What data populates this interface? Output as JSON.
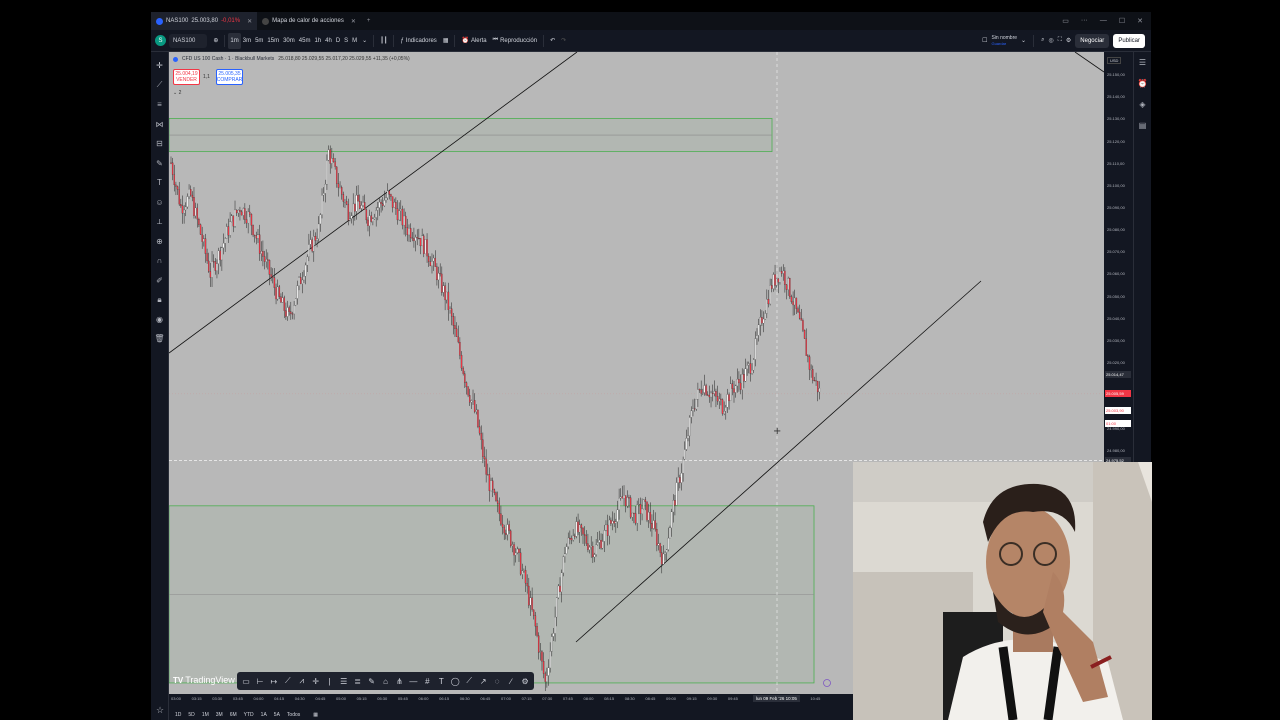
{
  "browser": {
    "tabs": [
      {
        "symbol": "NAS100",
        "price": "25.003,80",
        "change": "-0,01%"
      },
      {
        "label": "Mapa de calor de acciones"
      }
    ],
    "new_tab": "+"
  },
  "toolbar": {
    "avatar_letter": "S",
    "symbol": "NAS100",
    "intervals": [
      "1m",
      "3m",
      "5m",
      "15m",
      "30m",
      "45m",
      "1h",
      "4h",
      "D",
      "S",
      "M"
    ],
    "active_interval": "1m",
    "indicators_label": "Indicadores",
    "alert_label": "Alerta",
    "replay_label": "Reproducción",
    "layout_name": "Sin nombre",
    "layout_sub": "Guardar",
    "trade_label": "Negociar",
    "publish_label": "Publicar"
  },
  "legend": {
    "title": "CFD US 100 Cash · 1 · Blackbull Markets",
    "ohlc": "25.018,80  25.029,55  25.017,20  25.029,55 +11,35 (+0,05%)",
    "sell_price": "25.004,19",
    "sell_label": "VENDER",
    "spread": "1,1",
    "buy_price": "25.005,35",
    "buy_label": "COMPRAR",
    "indicator_count": "2"
  },
  "price_axis": {
    "currency": "USD",
    "ticks": [
      "25.150,00",
      "25.140,00",
      "25.130,00",
      "25.120,00",
      "25.110,00",
      "25.100,00",
      "25.090,00",
      "25.080,00",
      "25.070,00",
      "25.060,00",
      "25.050,00",
      "25.040,00",
      "25.030,00",
      "25.020,00",
      "24.990,00",
      "24.980,00",
      "24.970,00"
    ],
    "last_price": "25.014,47",
    "current_price": "25.005,59",
    "current_price_2": "25.003,90",
    "countdown": "01:00",
    "crosshair_price": "24.975,52"
  },
  "time_axis": {
    "ticks": [
      "03:00",
      "03:15",
      "03:30",
      "03:45",
      "04:00",
      "04:15",
      "04:30",
      "04:45",
      "05:00",
      "05:15",
      "05:30",
      "05:45",
      "06:00",
      "06:15",
      "06:30",
      "06:45",
      "07:00",
      "07:15",
      "07:30",
      "07:45",
      "08:00",
      "08:15",
      "08:30",
      "08:45",
      "09:00",
      "09:15",
      "09:30",
      "09:45",
      "10:00",
      "10:15",
      "10:30",
      "10:45"
    ],
    "crosshair_date": "lun 09 Feb '26   10:05"
  },
  "logo": "TradingView",
  "ranges": [
    "1D",
    "5D",
    "1M",
    "3M",
    "6M",
    "YTD",
    "1A",
    "5A",
    "Todos"
  ],
  "icons": {
    "left": [
      "crosshair-icon",
      "trendline-icon",
      "fib-icon",
      "pattern-icon",
      "prediction-icon",
      "brush-icon",
      "text-icon",
      "emoji-icon",
      "ruler-icon",
      "zoom-icon",
      "magnet-icon",
      "stay-drawing-icon",
      "lock-icon",
      "hide-icon",
      "trash-icon"
    ],
    "right": [
      "watchlist-icon",
      "alerts-icon",
      "layers-icon",
      "notes-icon"
    ]
  },
  "colors": {
    "bg": "#131722",
    "chart_bg": "#b8b8b8",
    "up": "#ffffff",
    "down": "#f23645",
    "zone": "#4caf50",
    "accent": "#2962ff"
  },
  "chart_data": {
    "type": "line",
    "series": [
      {
        "values": [
          25110,
          25090,
          25095,
          25078,
          25060,
          25070,
          25082,
          25090,
          25085,
          25072,
          25060,
          25048,
          25040,
          25055,
          25070,
          25080,
          25115,
          25100,
          25088,
          25092,
          25085,
          25090,
          25095,
          25088,
          25080,
          25078,
          25070,
          25060,
          25048,
          25030,
          25010,
          24995,
          24970,
          24955,
          24945,
          24935,
          24920,
          24900,
          24875,
          24905,
          24935,
          24945,
          24940,
          24935,
          24942,
          24950,
          24960,
          24950,
          24955,
          24945,
          24930,
          24955,
          24975,
          25000,
          25010,
          25005,
          25000,
          25008,
          25012,
          25020,
          25040,
          25055,
          25062,
          25050,
          25035,
          25015,
          25005
        ]
      }
    ],
    "zones": [
      [
        25130,
        25115
      ],
      [
        24955,
        24875
      ]
    ],
    "ylim": [
      24870,
      25160
    ]
  }
}
